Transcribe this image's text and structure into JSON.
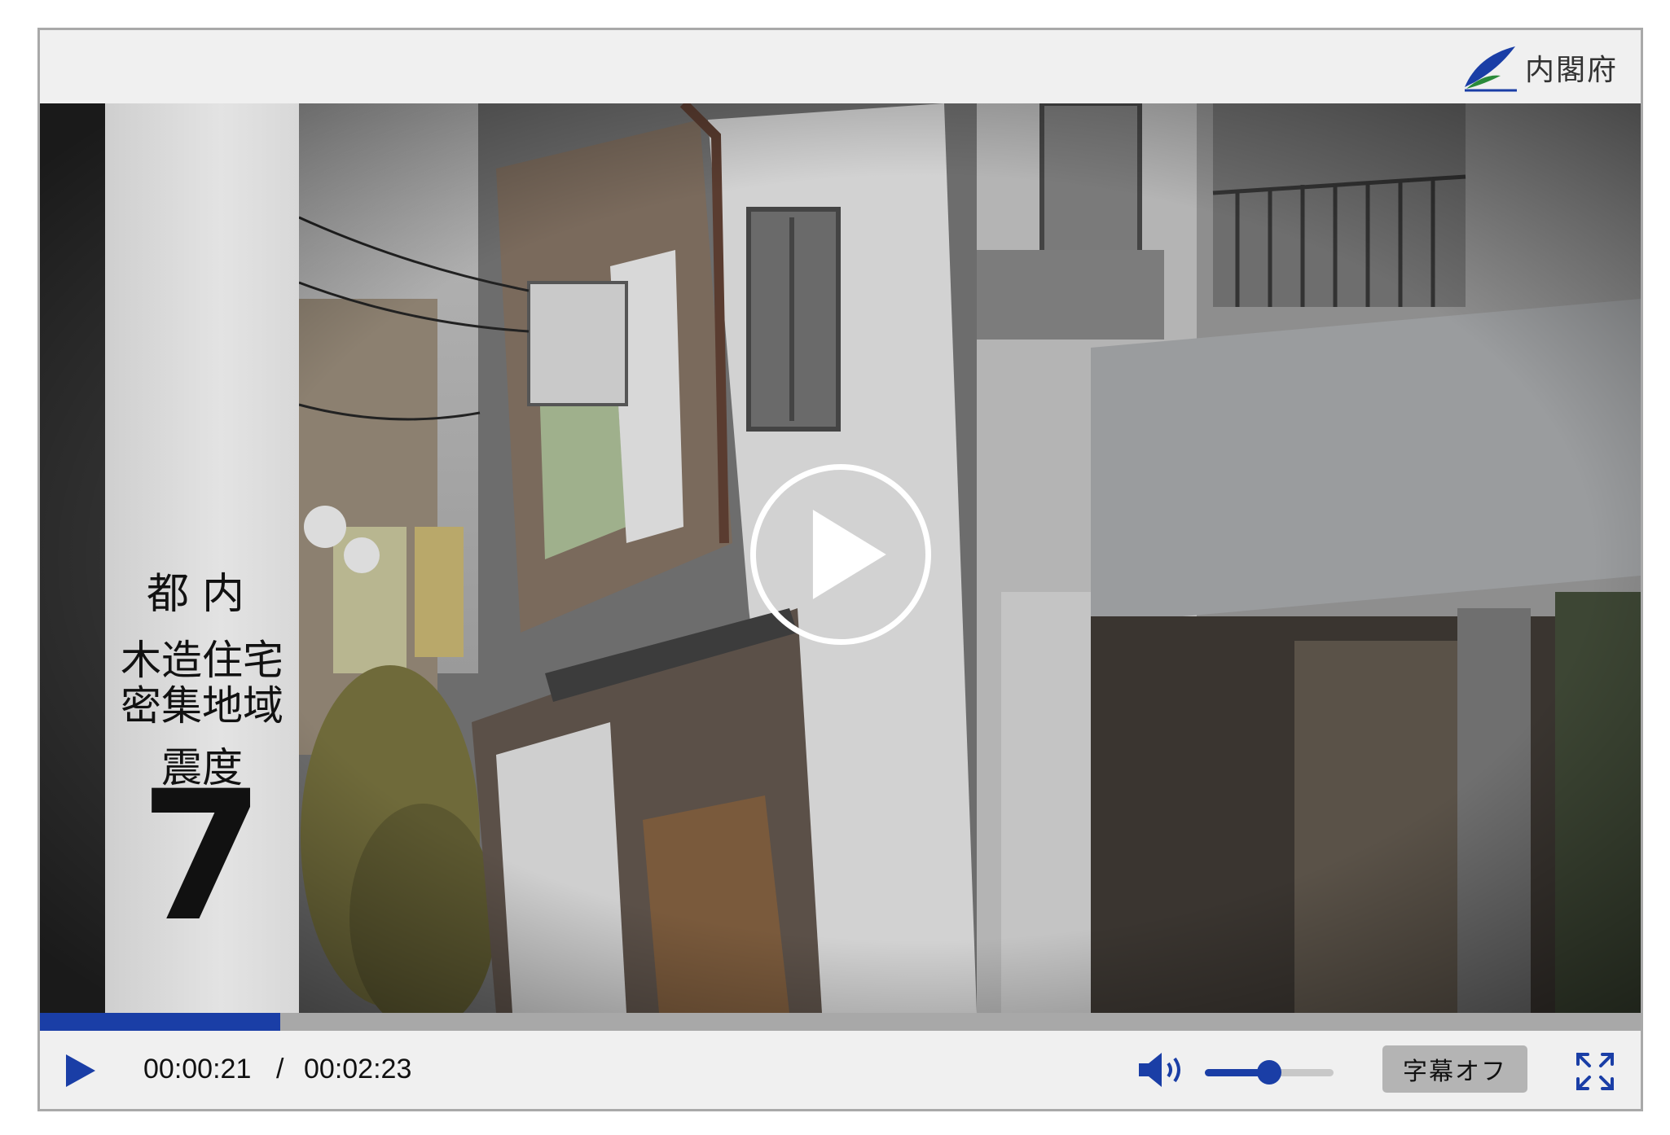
{
  "brand": {
    "logo_text": "内閣府"
  },
  "video": {
    "caption": {
      "line1": "都内",
      "line2a": "木造住宅",
      "line2b": "密集地域",
      "line3": "震度",
      "line4": "7"
    }
  },
  "controls": {
    "current_time": "00:00:21",
    "separator": "/",
    "duration": "00:02:23",
    "progress_fraction": 0.15,
    "volume_fraction": 0.5,
    "subtitle_button": "字幕オフ"
  },
  "colors": {
    "accent": "#1a3ea6",
    "logo_green": "#2a8a3a"
  }
}
